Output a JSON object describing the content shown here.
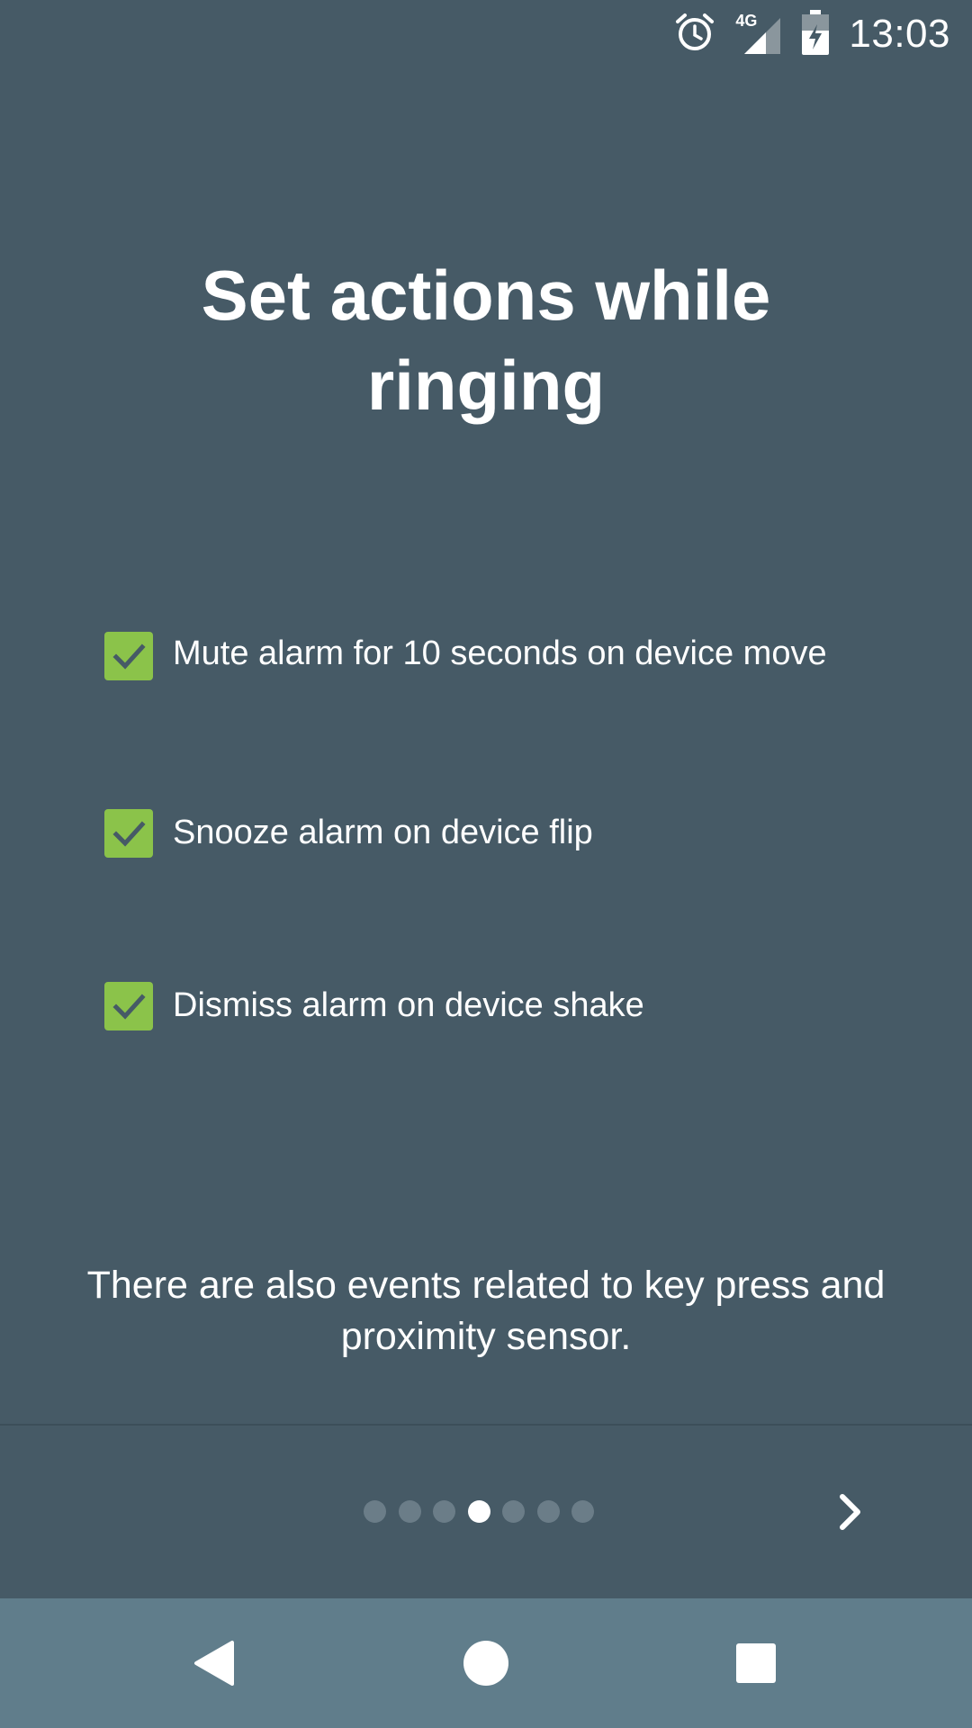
{
  "status_bar": {
    "time": "13:03",
    "icons": [
      "alarm-clock-icon",
      "signal-4g-icon",
      "battery-charging-icon"
    ],
    "network_label": "4G"
  },
  "intro": {
    "title": "Set actions while ringing",
    "options": [
      {
        "label": "Mute alarm for 10 seconds on device move",
        "checked": true
      },
      {
        "label": "Snooze alarm on device flip",
        "checked": true
      },
      {
        "label": "Dismiss alarm on device shake",
        "checked": true
      }
    ],
    "footer": "There are also events related to key press and proximity sensor."
  },
  "pager": {
    "total_pages": 7,
    "current_page": 4,
    "next_icon": "chevron-right-icon"
  },
  "nav_bar": {
    "icons": [
      "back-icon",
      "home-icon",
      "recents-icon"
    ]
  },
  "colors": {
    "background": "#465a66",
    "checkbox": "#8bc34a",
    "check_mark": "#465a66",
    "nav_bar": "#607d8b",
    "dot_inactive": "#6b7d88",
    "dot_active": "#ffffff"
  }
}
